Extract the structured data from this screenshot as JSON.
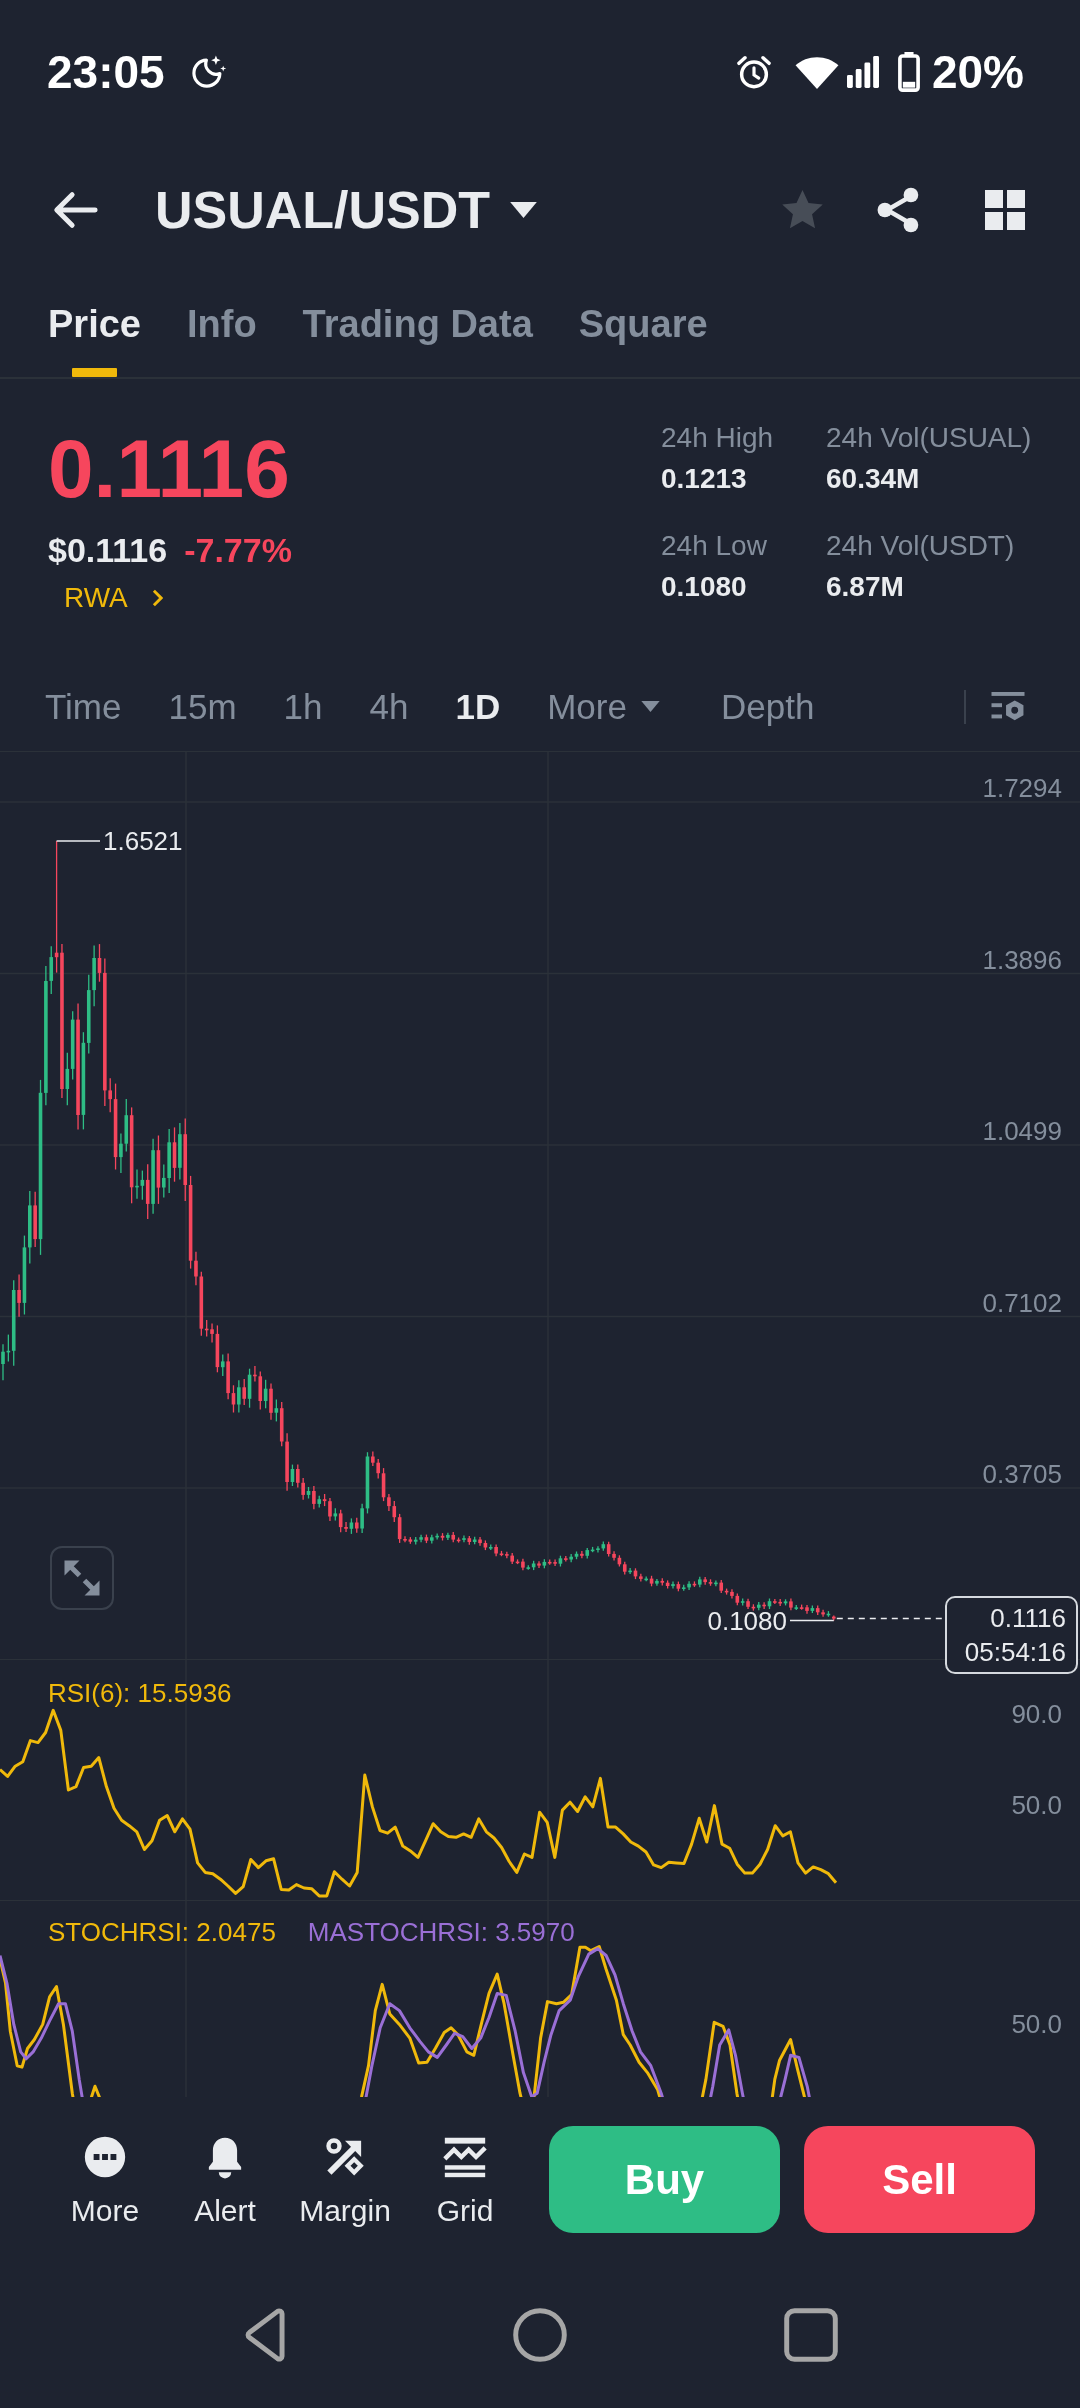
{
  "status_bar": {
    "time": "23:05",
    "battery": "20%"
  },
  "header": {
    "title": "USUAL/USDT",
    "favorite": false
  },
  "tabs": [
    {
      "label": "Price",
      "selected": true
    },
    {
      "label": "Info",
      "selected": false
    },
    {
      "label": "Trading Data",
      "selected": false
    },
    {
      "label": "Square",
      "selected": false
    }
  ],
  "price_panel": {
    "last_price": "0.1116",
    "rising": false,
    "usd_price": "$0.1116",
    "change": "-7.77%",
    "tag": "RWA",
    "stats": [
      {
        "label": "24h High",
        "value": "0.1213"
      },
      {
        "label": "24h Vol(USUAL)",
        "value": "60.34M"
      },
      {
        "label": "24h Low",
        "value": "0.1080"
      },
      {
        "label": "24h Vol(USDT)",
        "value": "6.87M"
      }
    ]
  },
  "intervals": [
    {
      "label": "Time",
      "kind": "option",
      "selected": false
    },
    {
      "label": "15m",
      "kind": "option",
      "selected": false
    },
    {
      "label": "1h",
      "kind": "option",
      "selected": false
    },
    {
      "label": "4h",
      "kind": "option",
      "selected": false
    },
    {
      "label": "1D",
      "kind": "option",
      "selected": true
    },
    {
      "label": "More",
      "kind": "dropdown",
      "selected": false
    },
    {
      "label": "Depth",
      "kind": "option",
      "selected": false
    }
  ],
  "kline_panel": {
    "price_axis": [
      "1.7294",
      "1.3896",
      "1.0499",
      "0.7102",
      "0.3705"
    ],
    "high_marker": "1.6521",
    "low_marker": "0.1080",
    "last_price_tag": {
      "price": "0.1116",
      "countdown": "05:54:16"
    }
  },
  "rsi_panel": {
    "chart_data": {
      "type": "line",
      "categories": [
        null,
        null,
        null,
        null,
        null,
        null,
        null,
        null,
        null,
        null,
        null,
        null,
        null,
        null,
        null,
        null,
        null,
        null,
        null,
        null,
        null,
        null,
        null,
        null,
        null,
        null,
        null,
        null,
        null,
        null,
        null,
        null,
        null,
        null,
        null,
        null,
        null,
        null,
        null,
        null,
        null,
        null,
        null,
        null,
        null,
        null,
        null,
        null,
        null,
        null,
        null,
        null,
        null,
        null,
        null,
        null,
        null,
        null,
        null,
        null,
        null,
        null,
        null,
        null,
        null,
        null,
        null,
        null,
        null,
        null,
        null,
        null,
        null,
        null,
        null,
        null,
        null,
        null,
        null,
        null,
        null,
        null,
        null,
        null,
        null,
        null,
        null,
        null,
        null,
        null,
        null,
        null,
        null,
        null,
        null,
        null,
        null,
        null,
        null,
        null,
        null,
        null,
        null,
        null,
        null,
        null,
        null,
        null,
        null,
        null,
        null
      ],
      "series": [
        {
          "name": "RSI(6): 15.5936",
          "color": "#f0b90b",
          "values": [
            65.6,
            62.6,
            67.1,
            69.1,
            78.4,
            77.5,
            82.0,
            91.8,
            82.9,
            56.6,
            58.1,
            66.5,
            67.1,
            70.9,
            58.1,
            48.5,
            43.2,
            40.8,
            38.1,
            30.3,
            34.2,
            43.2,
            45.3,
            38.1,
            43.8,
            39.3,
            24.4,
            20.2,
            19.6,
            17.2,
            14.2,
            10.9,
            13.9,
            25.9,
            22.3,
            25.3,
            26.2,
            12.7,
            12.4,
            14.8,
            13.3,
            13.0,
            9.8,
            9.8,
            20.5,
            17.2,
            14.2,
            20.2,
            63.2,
            49.1,
            38.7,
            37.5,
            40.2,
            31.8,
            29.7,
            26.8,
            34.2,
            41.7,
            38.1,
            36.0,
            35.7,
            37.2,
            35.7,
            43.8,
            38.1,
            35.4,
            31.2,
            25.0,
            20.2,
            28.3,
            26.8,
            46.8,
            42.3,
            26.8,
            47.7,
            51.2,
            47.1,
            53.6,
            49.1,
            61.7,
            40.2,
            40.2,
            37.2,
            33.6,
            31.8,
            29.2,
            23.5,
            22.3,
            24.7,
            24.4,
            24.1,
            32.7,
            44.1,
            33.6,
            49.7,
            32.7,
            30.9,
            23.8,
            19.9,
            19.9,
            23.8,
            30.3,
            40.8,
            36.3,
            38.1,
            24.4,
            19.9,
            22.6,
            21.4,
            19.6,
            15.6
          ]
        }
      ],
      "ylim": [
        8,
        114
      ],
      "yticks": [
        {
          "value": 90,
          "label": "90.0"
        },
        {
          "value": 50,
          "label": "50.0"
        }
      ]
    }
  },
  "stochrsi_panel": {
    "legends": [
      {
        "text": "STOCHRSI: 2.0475",
        "color": "#f0b90b"
      },
      {
        "text": "MASTOCHRSI: 3.5970",
        "color": "#9a6fd6"
      }
    ],
    "axis_label": "50.0"
  },
  "action_bar": {
    "tools": [
      {
        "label": "More",
        "kind": "more"
      },
      {
        "label": "Alert",
        "kind": "alert"
      },
      {
        "label": "Margin",
        "kind": "margin"
      },
      {
        "label": "Grid",
        "kind": "grid"
      }
    ],
    "buttons": [
      {
        "label": "Buy",
        "kind": "buy"
      },
      {
        "label": "Sell",
        "kind": "sell"
      }
    ]
  }
}
